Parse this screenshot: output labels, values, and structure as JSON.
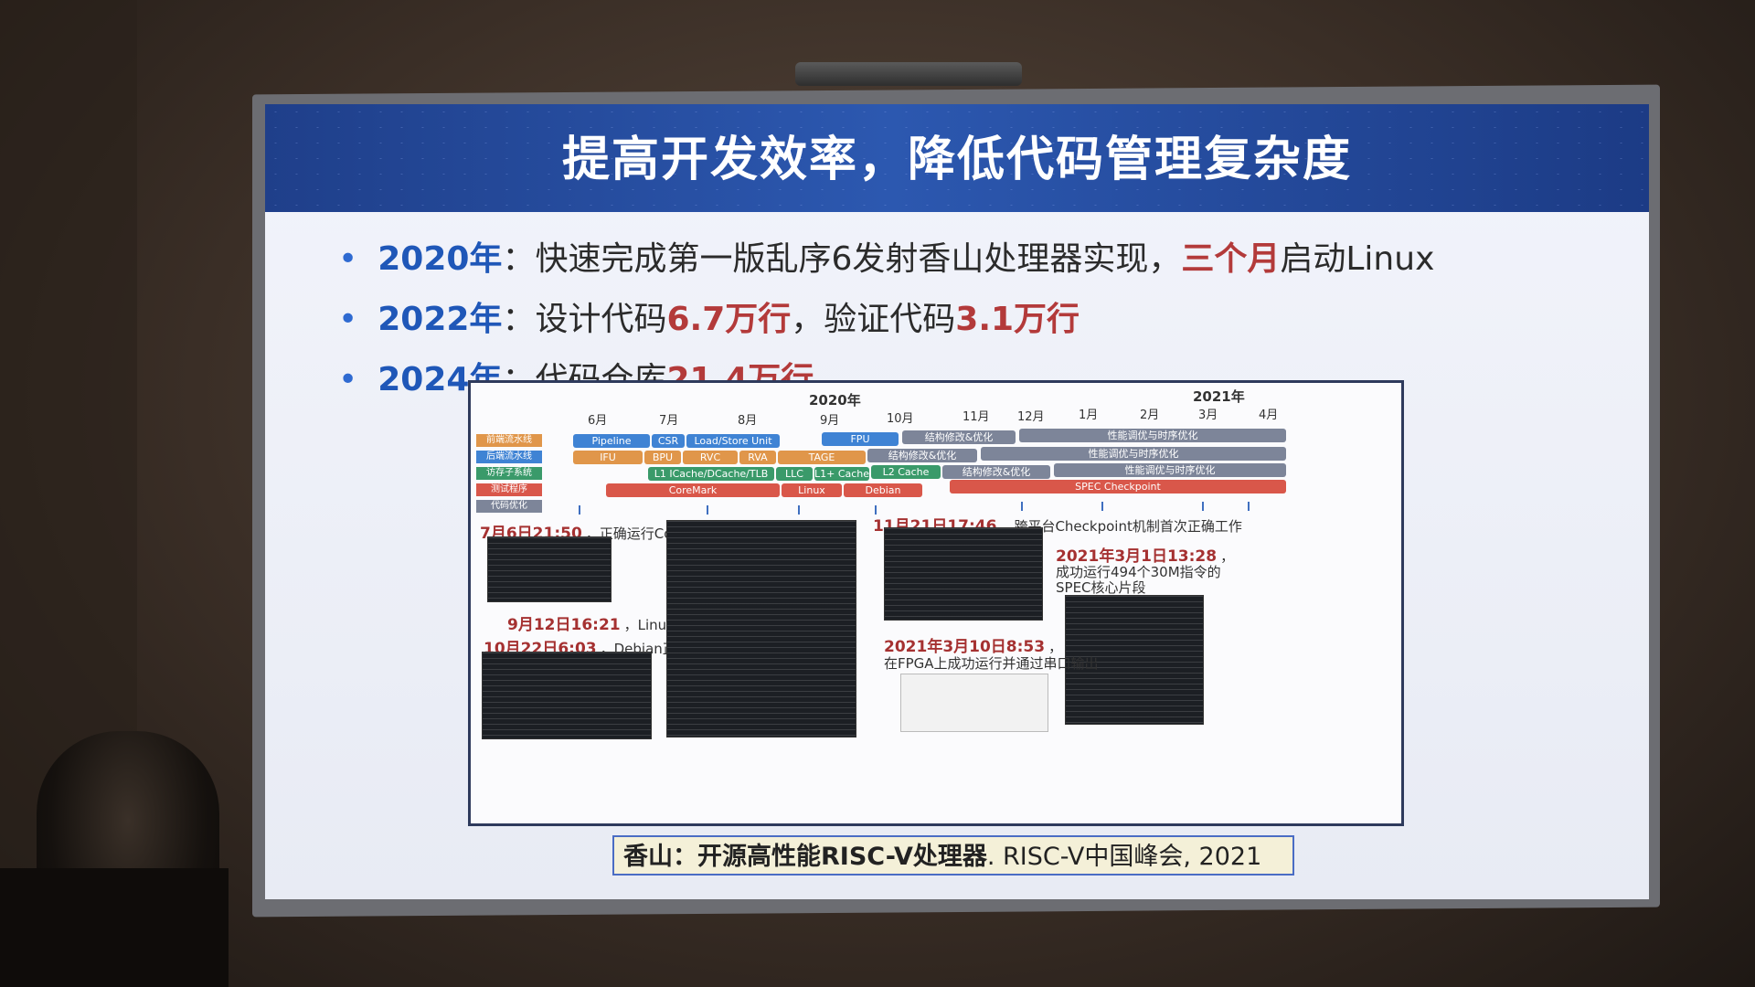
{
  "slide": {
    "title": "提高开发效率，降低代码管理复杂度",
    "bullets": [
      {
        "year": "2020年",
        "sep": "：",
        "text1": "快速完成第一版乱序6发射香山处理器实现，",
        "highlight": "三个月",
        "text2": "启动Linux"
      },
      {
        "year": "2022年",
        "sep": "：",
        "text1": "设计代码",
        "highlight": "6.7万行",
        "text2": "，验证代码",
        "highlight2": "3.1万行"
      },
      {
        "year": "2024年",
        "sep": "：",
        "text1": "代码仓库",
        "highlight": "21.4万行"
      }
    ],
    "timeline": {
      "year_2020": "2020年",
      "year_2021": "2021年",
      "months": [
        "6月",
        "7月",
        "8月",
        "9月",
        "10月",
        "11月",
        "12月",
        "1月",
        "2月",
        "3月",
        "4月"
      ],
      "legend": [
        "前端流水线",
        "后端流水线",
        "访存子系统",
        "测试程序",
        "代码优化"
      ],
      "bars": [
        "Pipeline",
        "CSR",
        "Load/Store Unit",
        "FPU",
        "结构修改&优化",
        "性能调优与时序优化",
        "IFU",
        "BPU",
        "RVC",
        "RVA",
        "TAGE",
        "结构修改&优化",
        "性能调优与时序优化",
        "L1 ICache/DCache/TLB",
        "LLC",
        "L1+ Cache",
        "L2 Cache",
        "结构修改&优化",
        "性能调优与时序优化",
        "CoreMark",
        "Linux",
        "Debian",
        "SPEC Checkpoint"
      ]
    },
    "annotations": [
      {
        "time": "7月6日21:50",
        "text": "，正确运行CoreMark"
      },
      {
        "time": "9月12日16:21",
        "text": "，Linux正确启动"
      },
      {
        "time": "10月22日6:03",
        "text": "，Debian正确启动"
      },
      {
        "time": "11月21日17:46",
        "text": "，跨平台Checkpoint机制首次正确工作"
      },
      {
        "time": "2021年3月1日13:28",
        "text": "，",
        "line2": "成功运行494个30M指令的",
        "line3": "SPEC核心片段"
      },
      {
        "time": "2021年3月10日8:53",
        "text": "，",
        "line2": "在FPGA上成功运行并通过串口输出"
      }
    ],
    "citation": {
      "bold": "香山：开源高性能RISC-V处理器",
      "rest": ". RISC-V中国峰会, 2021"
    }
  },
  "colors": {
    "header": "#2c58b0",
    "year_blue": "#1f57b8",
    "highlight_red": "#b33a3a"
  }
}
